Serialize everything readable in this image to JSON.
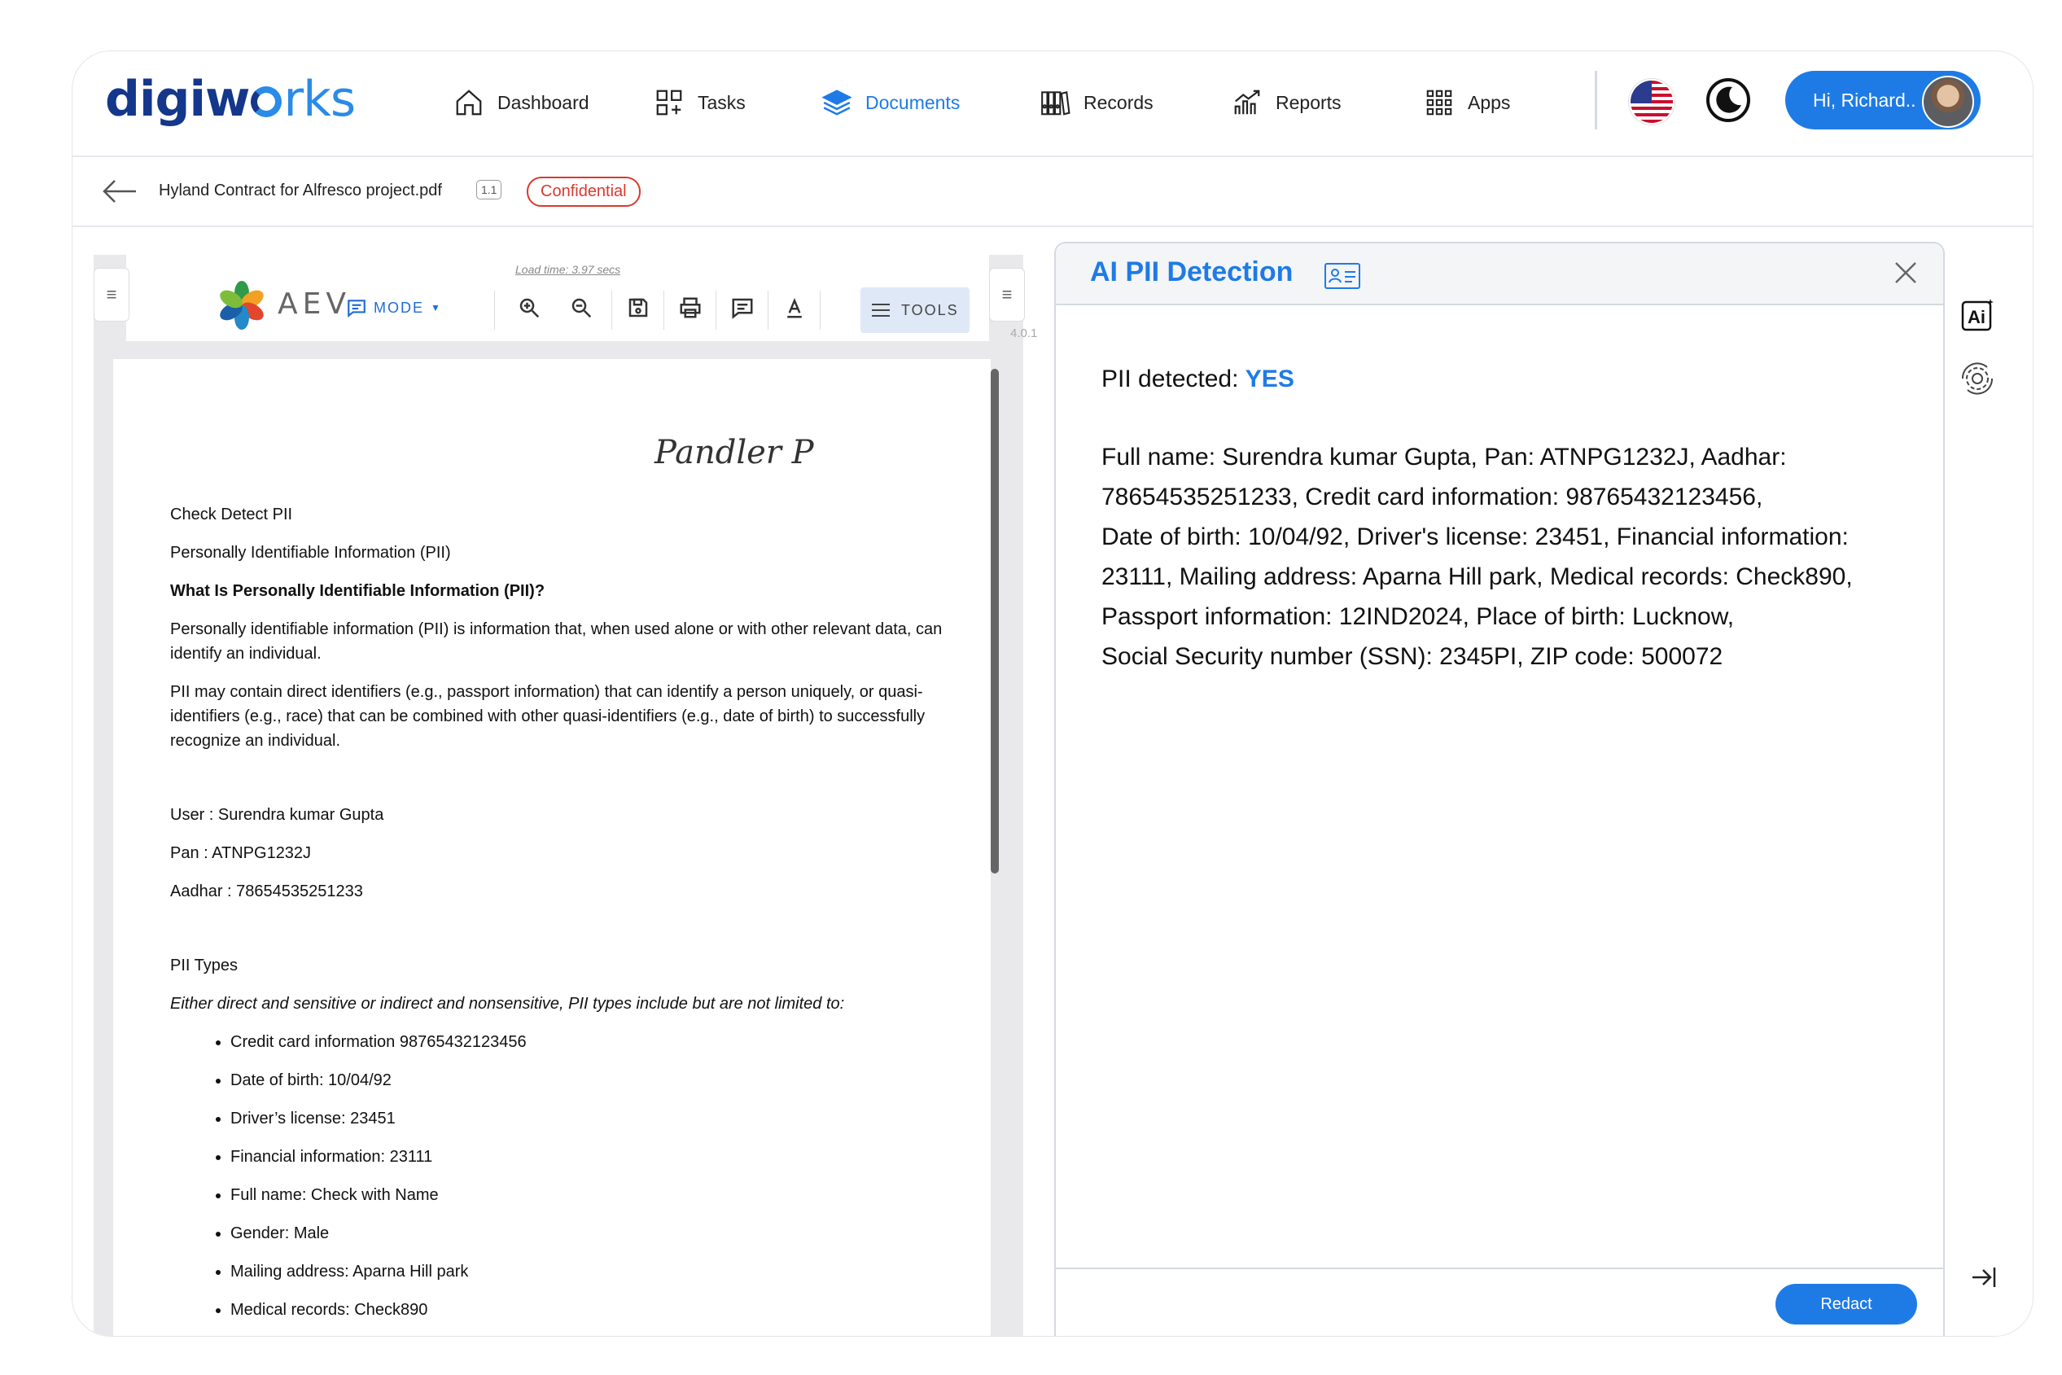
{
  "brand": {
    "logo_prefix": "digiw",
    "logo_suffix": "rks"
  },
  "nav": {
    "dashboard": "Dashboard",
    "tasks": "Tasks",
    "documents": "Documents",
    "records": "Records",
    "reports": "Reports",
    "apps": "Apps",
    "user_greeting": "Hi, Richard..",
    "accent_color": "#1e7be6"
  },
  "breadcrumb": {
    "filename": "Hyland Contract for Alfresco project.pdf",
    "version": "1.1",
    "badge": "Confidential"
  },
  "viewer": {
    "brand": "AEV",
    "load_time": "Load time: 3.97 secs",
    "mode_label": "MODE",
    "tools_label": "TOOLS",
    "version": "4.0.1",
    "signature": "Pandler P",
    "doc": {
      "line1": "Check Detect PII",
      "line2": "Personally Identifiable Information (PII)",
      "heading": "What Is Personally Identifiable Information (PII)?",
      "para1": "Personally identifiable information (PII) is information that, when used alone or with other relevant data, can identify an individual.",
      "para2": "PII may contain direct identifiers (e.g., passport information) that can identify a person uniquely, or quasi-identifiers (e.g., race) that can be combined with other quasi-identifiers (e.g., date of birth) to successfully recognize an individual.",
      "user": "User : Surendra kumar Gupta",
      "pan": "Pan : ATNPG1232J",
      "aadhar": "Aadhar : 78654535251233",
      "types_title": "PII Types",
      "types_intro": "Either direct and sensitive or indirect and nonsensitive, PII types include but are not limited to:",
      "bullets": [
        "Credit card information 98765432123456",
        "Date of birth: 10/04/92",
        "Driver’s license: 23451",
        "Financial information: 23111",
        "Full name: Check with Name",
        "Gender: Male",
        "Mailing address: Aparna Hill park",
        "Medical records: Check890"
      ]
    }
  },
  "ai_panel": {
    "title": "AI PII Detection",
    "detected_label": "PII detected:",
    "detected_value": "YES",
    "lines": [
      "Full name: Surendra kumar Gupta, Pan: ATNPG1232J, Aadhar:",
      "78654535251233, Credit card information: 98765432123456,",
      "Date of birth: 10/04/92, Driver's license: 23451, Financial information:",
      "23111, Mailing address: Aparna Hill park, Medical records: Check890,",
      "Passport information: 12IND2024, Place of birth: Lucknow,",
      "Social Security number (SSN): 2345PI, ZIP code: 500072"
    ],
    "redact_label": "Redact",
    "ai_icon_label": "Ai"
  }
}
